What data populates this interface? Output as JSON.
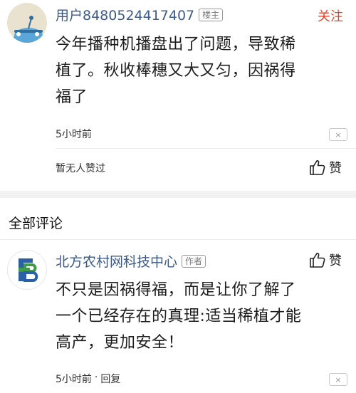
{
  "post": {
    "author": "用户8480524417407",
    "author_tag": "楼主",
    "follow_label": "关注",
    "lines": [
      "今年播种机播盘出了问题，导致稀",
      "植了。秋收棒穗又大又匀，因祸得",
      "福了"
    ],
    "time": "5小时前",
    "dismiss_label": "×",
    "no_likes": "暂无人赞过",
    "like_label": "赞"
  },
  "comments_section": {
    "title": "全部评论"
  },
  "comment": {
    "author": "北方农村网科技中心",
    "author_tag": "作者",
    "like_label": "赞",
    "lines": [
      "不只是因祸得福，而是让你了解了",
      "一个已经存在的真理:适当稀植才能",
      "高产，更加安全！"
    ],
    "time": "5小时前",
    "reply_label": "回复",
    "separator": "·",
    "dismiss_label": "×"
  },
  "colors": {
    "author": "#3d5a8a",
    "follow": "#e0452e",
    "divider": "#f2f2f2"
  },
  "icons": {
    "like": "thumbs-up-icon",
    "dismiss": "close-icon"
  }
}
